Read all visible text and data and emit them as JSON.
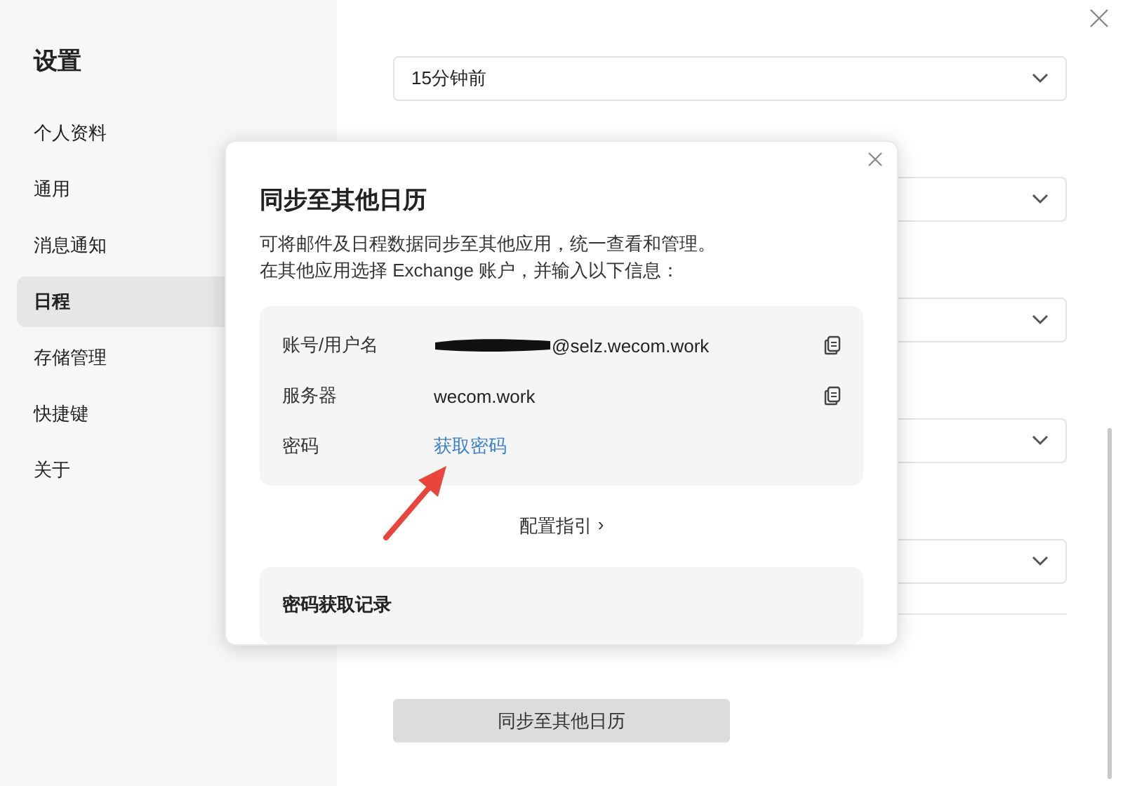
{
  "sidebar": {
    "title": "设置",
    "items": [
      {
        "label": "个人资料",
        "selected": false
      },
      {
        "label": "通用",
        "selected": false
      },
      {
        "label": "消息通知",
        "selected": false
      },
      {
        "label": "日程",
        "selected": true
      },
      {
        "label": "存储管理",
        "selected": false
      },
      {
        "label": "快捷键",
        "selected": false
      },
      {
        "label": "关于",
        "selected": false
      }
    ]
  },
  "settings": {
    "dropdowns": [
      {
        "kind": "select",
        "value": "15分钟前"
      },
      {
        "kind": "select"
      },
      {
        "kind": "select"
      },
      {
        "kind": "select"
      },
      {
        "kind": "select"
      }
    ],
    "sync_button": "同步至其他日历"
  },
  "dialog": {
    "title": "同步至其他日历",
    "description": [
      "可将邮件及日程数据同步至其他应用，统一查看和管理。",
      "在其他应用选择 Exchange 账户，并输入以下信息："
    ],
    "fields": [
      {
        "kind": "copy",
        "label": "账号/用户名",
        "value": "@selz.wecom.work",
        "redacted": true
      },
      {
        "kind": "copy",
        "label": "服务器",
        "value": "wecom.work",
        "redacted": false
      },
      {
        "kind": "link",
        "label": "密码",
        "value": "获取密码"
      }
    ],
    "guide_link": "配置指引",
    "guide_chevron": "›",
    "record_title": "密码获取记录"
  }
}
